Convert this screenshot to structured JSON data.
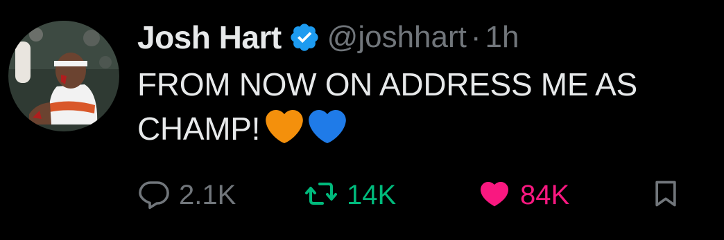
{
  "tweet": {
    "author": {
      "display_name": "Josh Hart",
      "handle": "@joshhart",
      "verified": true,
      "avatar_icon": "profile-photo"
    },
    "separator": "·",
    "time": "1h",
    "text_line1": "FROM NOW ON ADDRESS ME AS",
    "text_line2": "CHAMP!",
    "emojis": [
      "orange-heart",
      "blue-heart"
    ]
  },
  "actions": {
    "reply_count": "2.1K",
    "retweet_count": "14K",
    "like_count": "84K",
    "liked": true,
    "retweeted": false
  },
  "colors": {
    "background": "#000000",
    "text": "#e7e9ea",
    "muted": "#71767b",
    "verified": "#1d9bf0",
    "retweet": "#00ba7c",
    "like": "#f91880",
    "orange_heart": "#f4900c",
    "blue_heart": "#1f7be8"
  }
}
